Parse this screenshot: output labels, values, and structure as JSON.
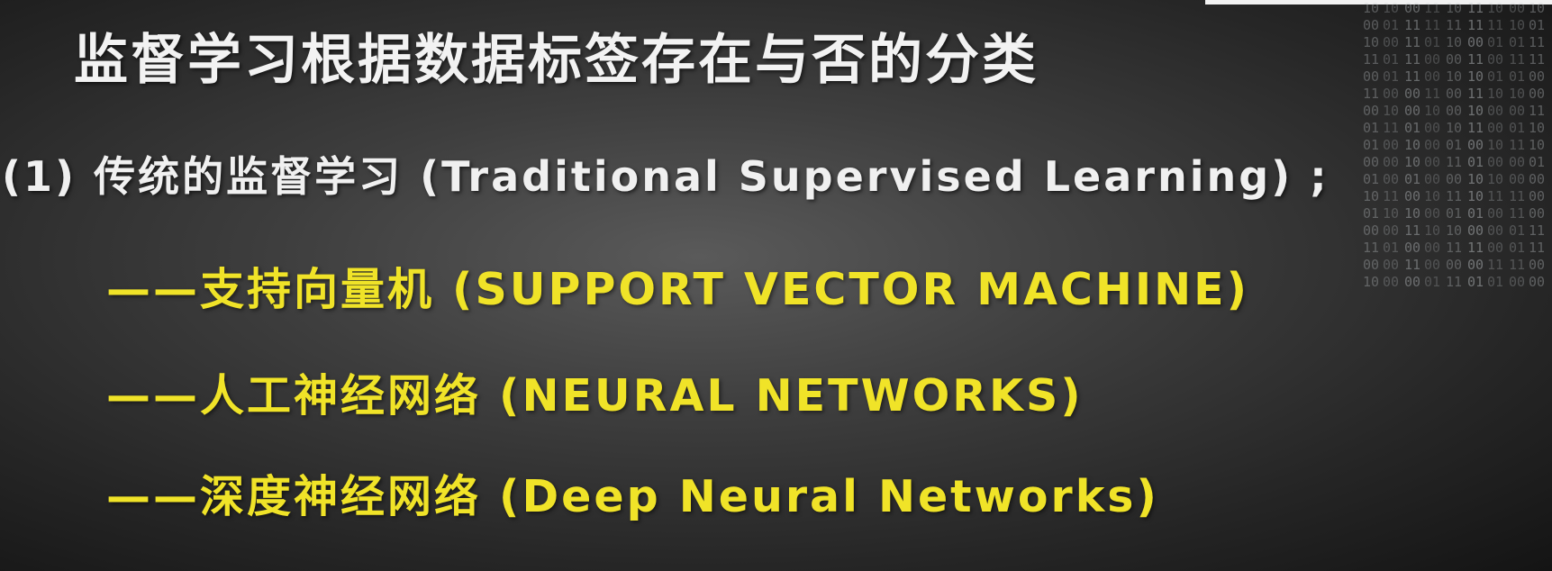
{
  "slide": {
    "title": "监督学习根据数据标签存在与否的分类",
    "subtitle": "(1) 传统的监督学习 (Traditional Supervised Learning) ;",
    "items": [
      "——支持向量机 (SUPPORT VECTOR MACHINE)",
      "——人工神经网络 (NEURAL NETWORKS)",
      "——深度神经网络 (Deep Neural Networks)"
    ]
  }
}
